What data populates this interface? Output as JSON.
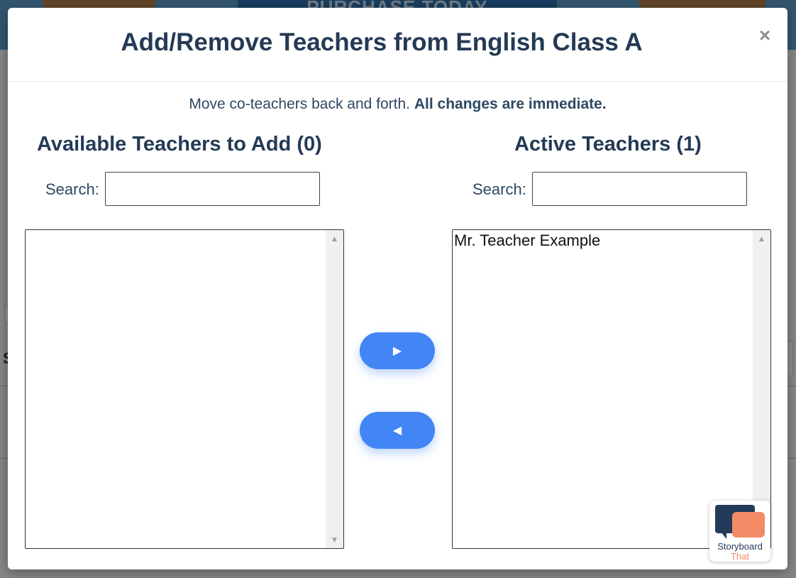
{
  "background": {
    "banner_text": "PURCHASE TODAY",
    "edge_letter": "S"
  },
  "modal": {
    "title": "Add/Remove Teachers from English Class A",
    "close_label": "×",
    "instruction_normal": "Move co-teachers back and forth.",
    "instruction_bold": "All changes are immediate."
  },
  "available": {
    "title": "Available Teachers to Add (0)",
    "search_label": "Search:",
    "search_value": "",
    "items": []
  },
  "active": {
    "title": "Active Teachers (1)",
    "search_label": "Search:",
    "search_value": "",
    "items": [
      "Mr. Teacher Example"
    ]
  },
  "buttons": {
    "add_label": "▶",
    "remove_label": "◀"
  },
  "scrollbar": {
    "up_glyph": "▲",
    "down_glyph": "▼"
  },
  "logo": {
    "line1": "Storyboard",
    "line2": "That"
  },
  "colors": {
    "accent": "#4285f4",
    "title": "#243a56",
    "logo_dark": "#233a5b",
    "logo_orange": "#f28b66"
  }
}
